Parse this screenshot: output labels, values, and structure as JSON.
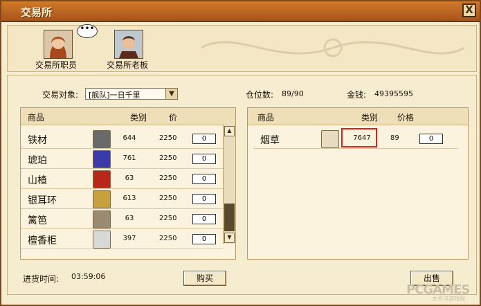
{
  "window": {
    "title": "交易所",
    "close_label": "X"
  },
  "npcs": [
    {
      "label": "交易所职员",
      "icon": "female-clerk-portrait"
    },
    {
      "label": "交易所老板",
      "icon": "male-boss-portrait"
    }
  ],
  "bubble": "•••",
  "trade": {
    "target_label": "交易对象:",
    "target_value": "[舰队]一日千里",
    "capacity_label": "仓位数:",
    "capacity_value": "89/90",
    "money_label": "金钱:",
    "money_value": "49395595"
  },
  "buy_list": {
    "headers": {
      "item": "商品",
      "category": "类别",
      "price": "价"
    },
    "rows": [
      {
        "name": "铁材",
        "icon": "iron-ore-icon",
        "category": "644",
        "price": "2250",
        "qty": "0"
      },
      {
        "name": "琥珀",
        "icon": "amber-gem-icon",
        "category": "761",
        "price": "2250",
        "qty": "0"
      },
      {
        "name": "山楂",
        "icon": "hawthorn-fruit-icon",
        "category": "63",
        "price": "2250",
        "qty": "0"
      },
      {
        "name": "银耳环",
        "icon": "silver-earring-icon",
        "category": "613",
        "price": "2250",
        "qty": "0"
      },
      {
        "name": "篱笆",
        "icon": "fence-axe-icon",
        "category": "63",
        "price": "2250",
        "qty": "0"
      },
      {
        "name": "檀香柜",
        "icon": "sandalwood-cabinet-icon",
        "category": "397",
        "price": "2250",
        "qty": "0"
      }
    ]
  },
  "sell_list": {
    "headers": {
      "item": "商品",
      "category": "类别",
      "price": "价格"
    },
    "rows": [
      {
        "name": "烟草",
        "icon": "tobacco-pipe-icon",
        "category": "7647",
        "price": "89",
        "qty": "0"
      }
    ]
  },
  "restock": {
    "label": "进货时间:",
    "value": "03:59:06"
  },
  "buttons": {
    "buy": "购买",
    "sell": "出售"
  },
  "watermark": {
    "main": "PCGAMES",
    "sub": "太平洋游戏网"
  },
  "colors": {
    "titlebar": "#b8621f",
    "highlight": "#e02020"
  }
}
